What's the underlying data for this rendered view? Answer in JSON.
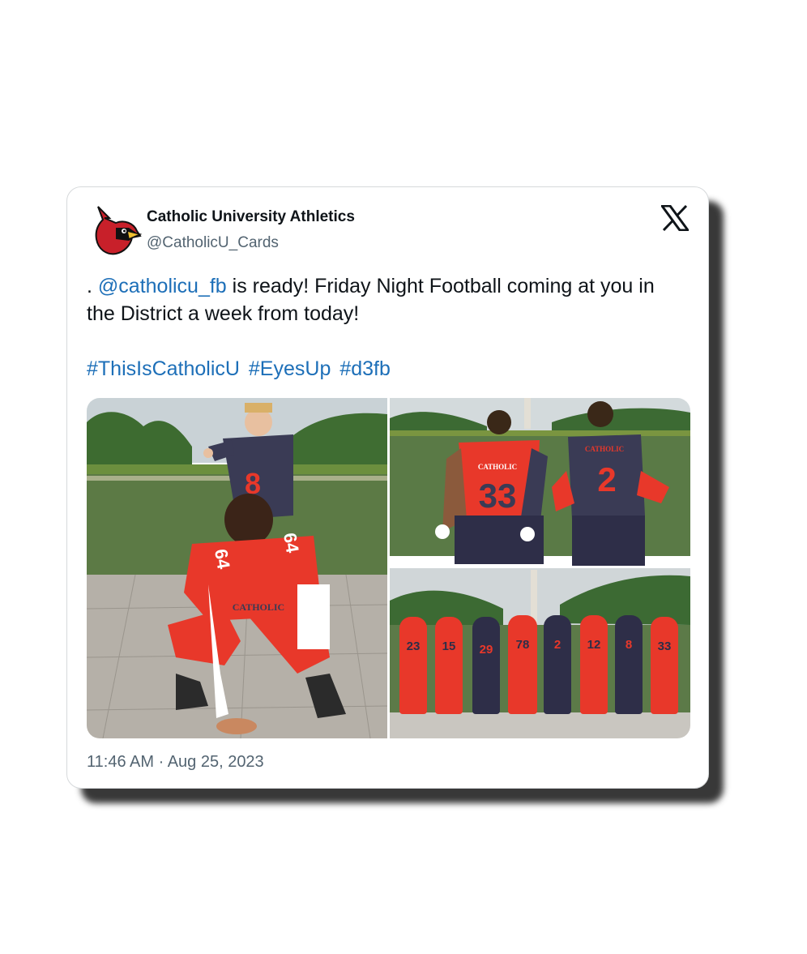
{
  "author": {
    "name": "Catholic University Athletics",
    "handle": "@CatholicU_Cards",
    "avatar_icon": "cardinal-logo-icon"
  },
  "platform_icon": "x-logo-icon",
  "tweet": {
    "prefix": ". ",
    "mention": "@catholicu_fb",
    "body": " is ready! Friday Night Football coming at you in the District a week from today!",
    "hashtags": [
      "#ThisIsCatholicU",
      "#EyesUp",
      "#d3fb"
    ]
  },
  "media": {
    "photo_1": {
      "jersey_numbers": [
        "8",
        "64",
        "64"
      ],
      "jersey_text": "CATHOLIC"
    },
    "photo_2": {
      "jersey_numbers": [
        "33",
        "2"
      ],
      "jersey_text": "CATHOLIC"
    },
    "photo_3": {
      "jersey_numbers": [
        "23",
        "15",
        "29",
        "78",
        "2",
        "12",
        "8",
        "33"
      ]
    }
  },
  "timestamp": "11:46 AM · Aug 25, 2023",
  "colors": {
    "link": "#1d6fb8",
    "text": "#0f1419",
    "muted": "#536471",
    "jersey_red": "#e8382a",
    "jersey_navy": "#3a3b55"
  }
}
